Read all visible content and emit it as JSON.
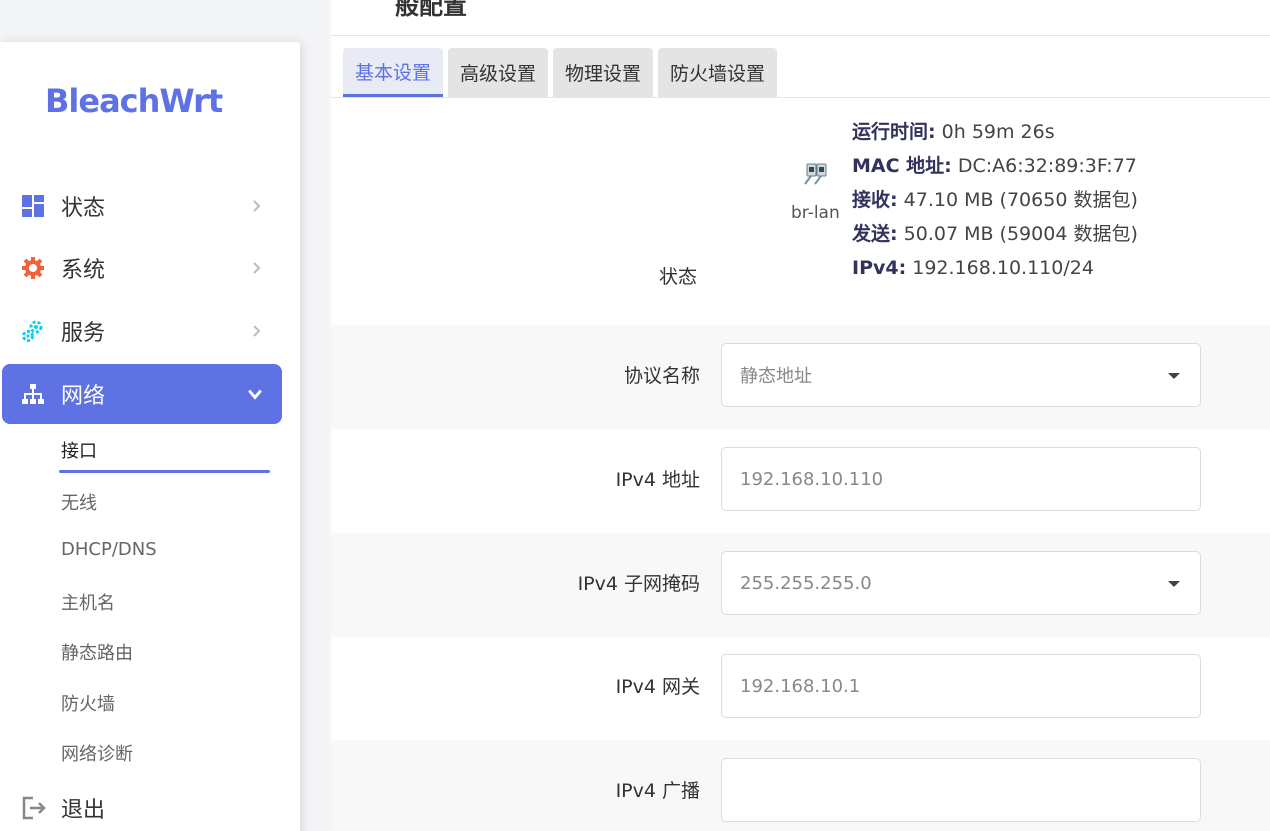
{
  "brand": {
    "name": "BleachWrt",
    "color": "#5e72e4"
  },
  "page": {
    "title": "般配置"
  },
  "nav": {
    "items": [
      {
        "label": "状态",
        "icon": "dashboard-icon"
      },
      {
        "label": "系统",
        "icon": "gear-icon"
      },
      {
        "label": "服务",
        "icon": "gears-icon"
      },
      {
        "label": "网络",
        "icon": "network-icon"
      }
    ],
    "sub_items": [
      "接口",
      "无线",
      "DHCP/DNS",
      "主机名",
      "静态路由",
      "防火墙",
      "网络诊断"
    ],
    "logout": "退出"
  },
  "tabs": [
    "基本设置",
    "高级设置",
    "物理设置",
    "防火墙设置"
  ],
  "status": {
    "label": "状态",
    "interface": "br-lan",
    "uptime_label": "运行时间:",
    "uptime": "0h 59m 26s",
    "mac_label": "MAC 地址:",
    "mac": "DC:A6:32:89:3F:77",
    "rx_label": "接收:",
    "rx": "47.10 MB (70650 数据包)",
    "tx_label": "发送:",
    "tx": "50.07 MB (59004 数据包)",
    "ipv4_label": "IPv4:",
    "ipv4": "192.168.10.110/24"
  },
  "form": {
    "protocol": {
      "label": "协议名称",
      "value": "静态地址"
    },
    "ipv4_addr": {
      "label": "IPv4 地址",
      "placeholder": "192.168.10.110"
    },
    "netmask": {
      "label": "IPv4 子网掩码",
      "value": "255.255.255.0"
    },
    "gateway": {
      "label": "IPv4 网关",
      "placeholder": "192.168.10.1"
    },
    "broadcast": {
      "label": "IPv4 广播",
      "placeholder": ""
    }
  }
}
